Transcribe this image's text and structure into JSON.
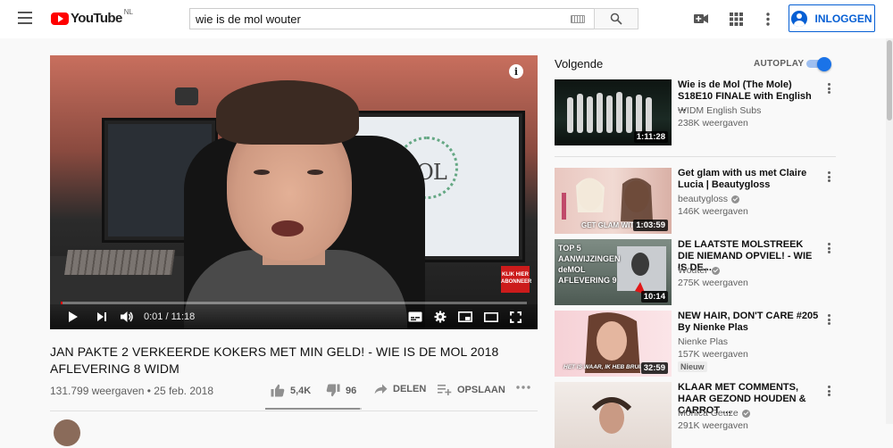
{
  "masthead": {
    "logo_text": "YouTube",
    "logo_region": "NL",
    "search_value": "wie is de mol wouter",
    "signin_label": "INLOGGEN",
    "icons": [
      "menu-icon",
      "keyboard-icon",
      "search-icon",
      "upload-video-icon",
      "apps-grid-icon",
      "more-vert-icon",
      "account-icon"
    ]
  },
  "player": {
    "time_current": "0:01",
    "time_total": "11:18",
    "time_display": "0:01 / 11:18",
    "progress_fraction": 0.0015,
    "overlay_text": "KLIK HIER ABONNEER",
    "screen_logo_text": "deMOL",
    "colors": {
      "progress": "#ff0000"
    }
  },
  "video": {
    "title": "JAN PAKTE 2 VERKEERDE KOKERS MET MIN GELD! - WIE IS DE MOL 2018 AFLEVERING 8 WIDM",
    "meta": "131.799 weergaven • 25 feb. 2018",
    "likes": "5,4K",
    "dislikes": "96",
    "share_label": "DELEN",
    "save_label": "OPSLAAN",
    "like_ratio": 0.98
  },
  "sidebar": {
    "up_next_label": "Volgende",
    "autoplay_label": "AUTOPLAY",
    "autoplay_on": true,
    "items": [
      {
        "title": "Wie is de Mol (The Mole) S18E10 FINALE with English ...",
        "channel": "WIDM English Subs",
        "views": "238K weergaven",
        "duration": "1:11:28",
        "verified": false,
        "badge": ""
      },
      {
        "title": "Get glam with us met Claire Lucia | Beautygloss",
        "channel": "beautygloss",
        "views": "146K weergaven",
        "duration": "1:03:59",
        "verified": true,
        "badge": "",
        "thumb_text": "GET GLAM WITH"
      },
      {
        "title": "DE LAATSTE MOLSTREEK DIE NIEMAND OPVIEL! - WIE IS DE...",
        "channel": "Wouter",
        "views": "275K weergaven",
        "duration": "10:14",
        "verified": true,
        "badge": "",
        "thumb_text": "TOP 5 AANWIJZINGEN deMOL AFLEVERING 9"
      },
      {
        "title": "NEW HAIR, DON'T CARE #205 By Nienke Plas",
        "channel": "Nienke Plas",
        "views": "157K weergaven",
        "duration": "32:59",
        "verified": false,
        "badge": "Nieuw",
        "thumb_text": "HET IS WAAR, IK HEB BRUIN"
      },
      {
        "title": "KLAAR MET COMMENTS, HAAR GEZOND HOUDEN & CARROT ...",
        "channel": "Monica Geuze",
        "views": "291K weergaven",
        "duration": "",
        "verified": true,
        "badge": ""
      }
    ]
  }
}
